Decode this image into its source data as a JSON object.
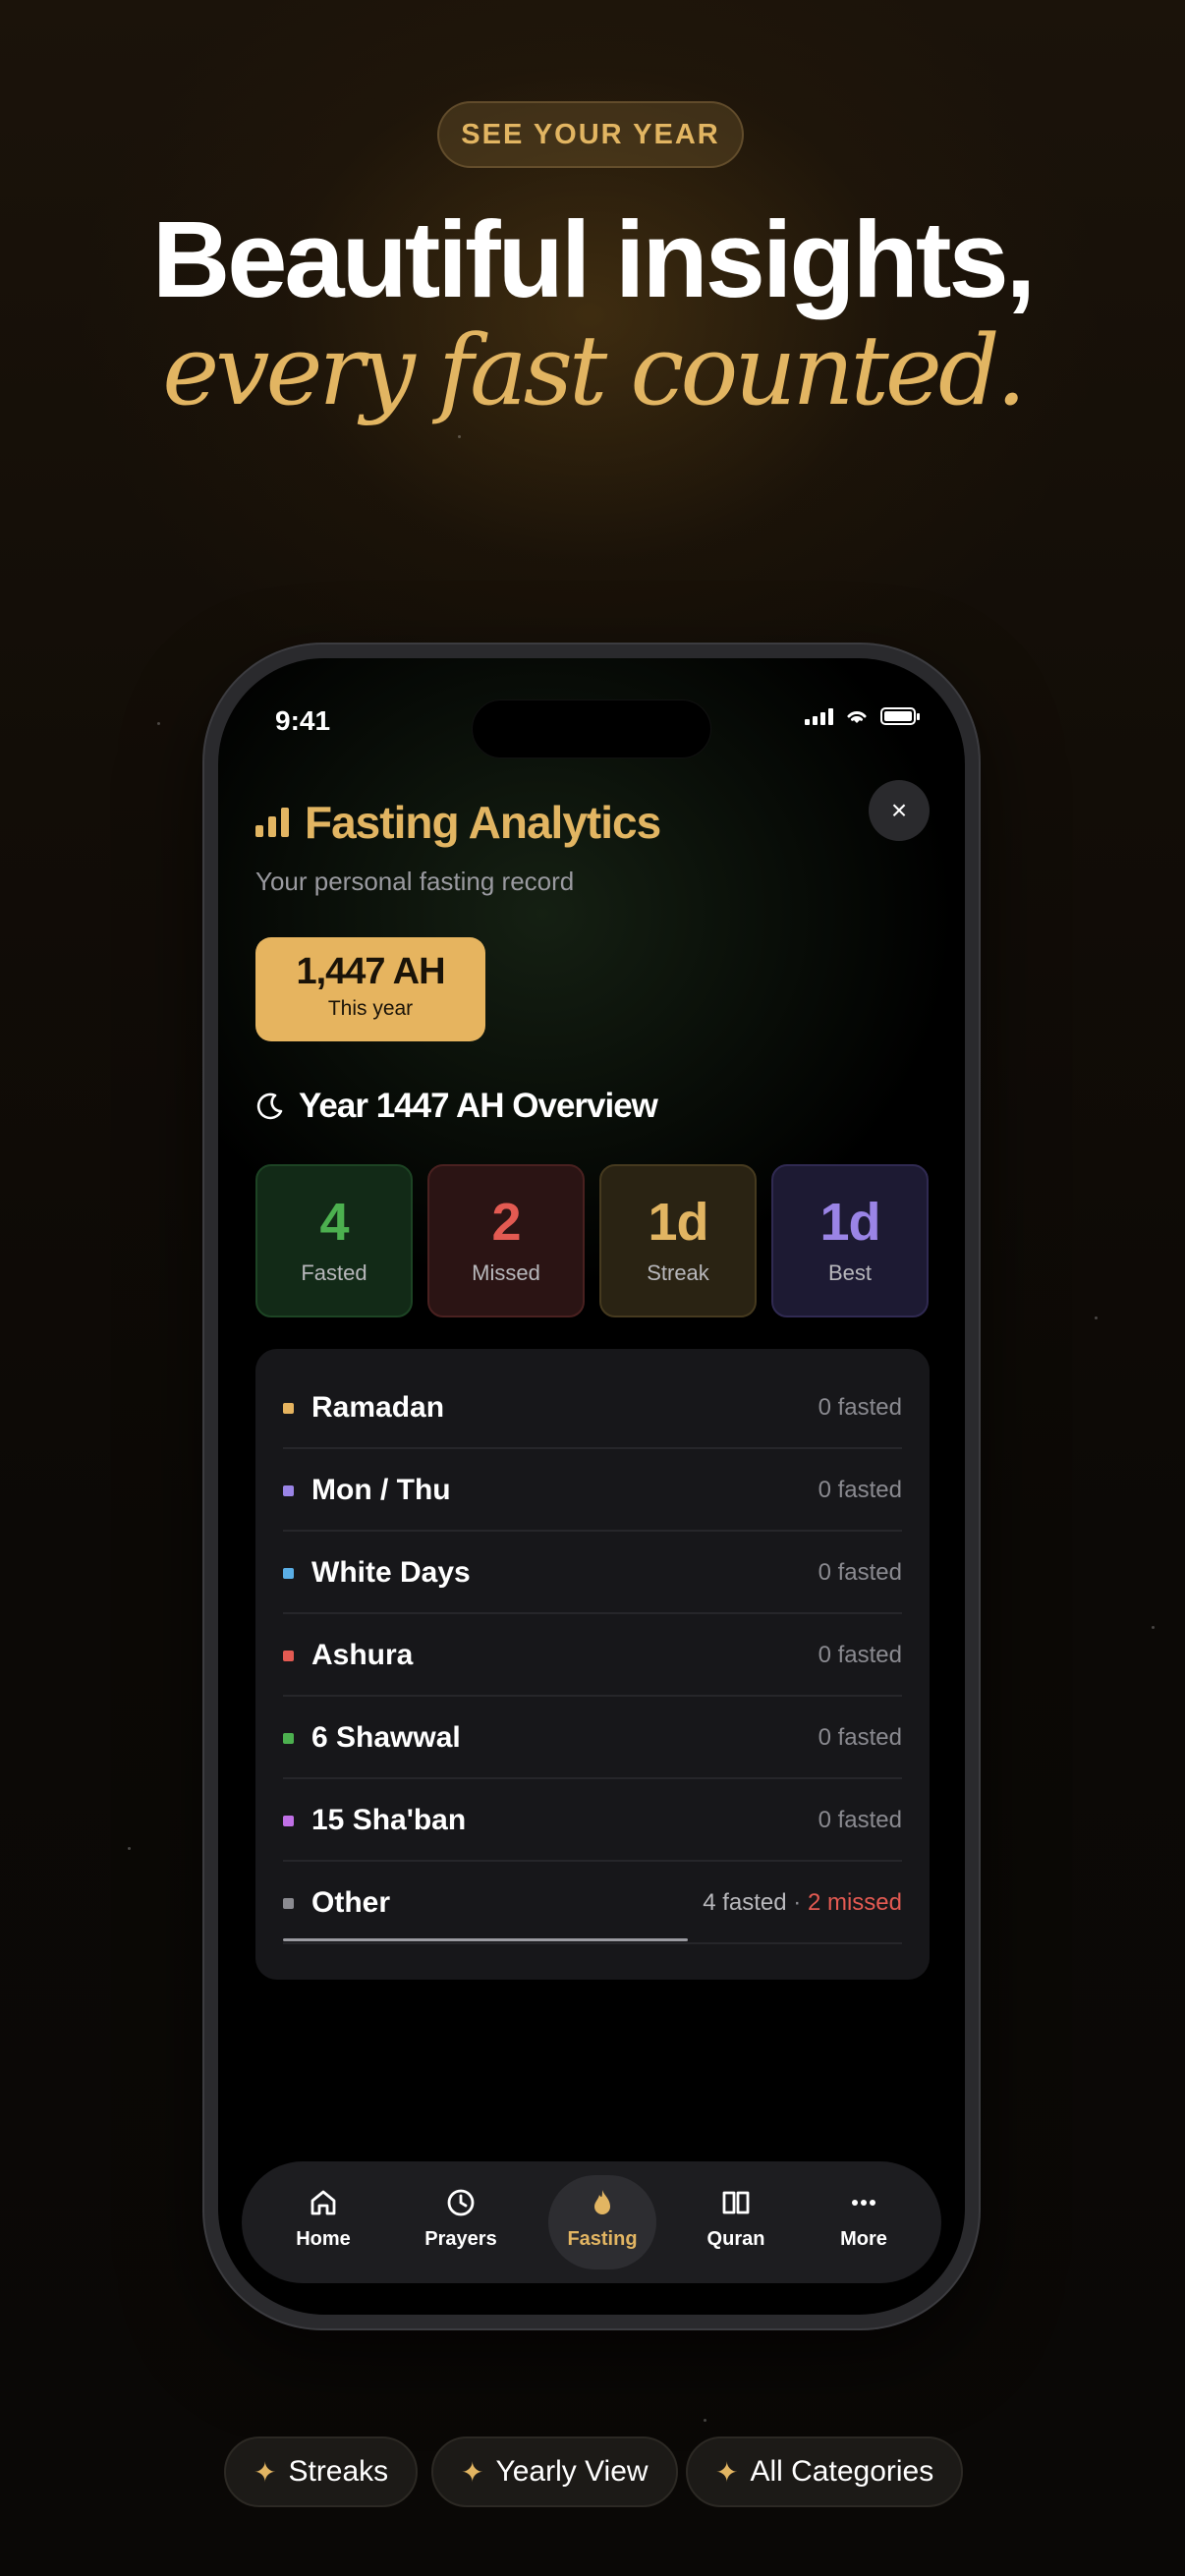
{
  "header": {
    "badge": "SEE YOUR YEAR",
    "headline": "Beautiful insights,",
    "subline": "every fast counted."
  },
  "status_bar": {
    "time": "9:41"
  },
  "analytics": {
    "title": "Fasting Analytics",
    "subtitle": "Your personal fasting record",
    "close_icon": "×",
    "year_card": {
      "value": "1,447 AH",
      "label": "This year"
    },
    "overview_title": "Year 1447 AH Overview",
    "stats": [
      {
        "value": "4",
        "label": "Fasted",
        "color": "#4cb04f"
      },
      {
        "value": "2",
        "label": "Missed",
        "color": "#e35a52"
      },
      {
        "value": "1d",
        "label": "Streak",
        "color": "#e2b562"
      },
      {
        "value": "1d",
        "label": "Best",
        "color": "#9a84e6"
      }
    ],
    "categories": [
      {
        "name": "Ramadan",
        "count": "0 fasted",
        "color": "#e6b45f"
      },
      {
        "name": "Mon / Thu",
        "count": "0 fasted",
        "color": "#9a84e6"
      },
      {
        "name": "White Days",
        "count": "0 fasted",
        "color": "#5aaee6"
      },
      {
        "name": "Ashura",
        "count": "0 fasted",
        "color": "#e35a52"
      },
      {
        "name": "6 Shawwal",
        "count": "0 fasted",
        "color": "#4cb04f"
      },
      {
        "name": "15 Sha'ban",
        "count": "0 fasted",
        "color": "#c070e6"
      },
      {
        "name": "Other",
        "count": "4 fasted",
        "separator": " · ",
        "missed": "2 missed",
        "color": "#8a8a90"
      }
    ]
  },
  "tabbar": {
    "tabs": [
      {
        "label": "Home",
        "icon": "home-icon"
      },
      {
        "label": "Prayers",
        "icon": "clock-icon"
      },
      {
        "label": "Fasting",
        "icon": "flame-icon",
        "active": true
      },
      {
        "label": "Quran",
        "icon": "book-icon"
      },
      {
        "label": "More",
        "icon": "more-icon"
      }
    ]
  },
  "features": [
    "Streaks",
    "Yearly View",
    "All Categories"
  ],
  "colors": {
    "accent": "#e2b562",
    "background": "#0c0906"
  }
}
